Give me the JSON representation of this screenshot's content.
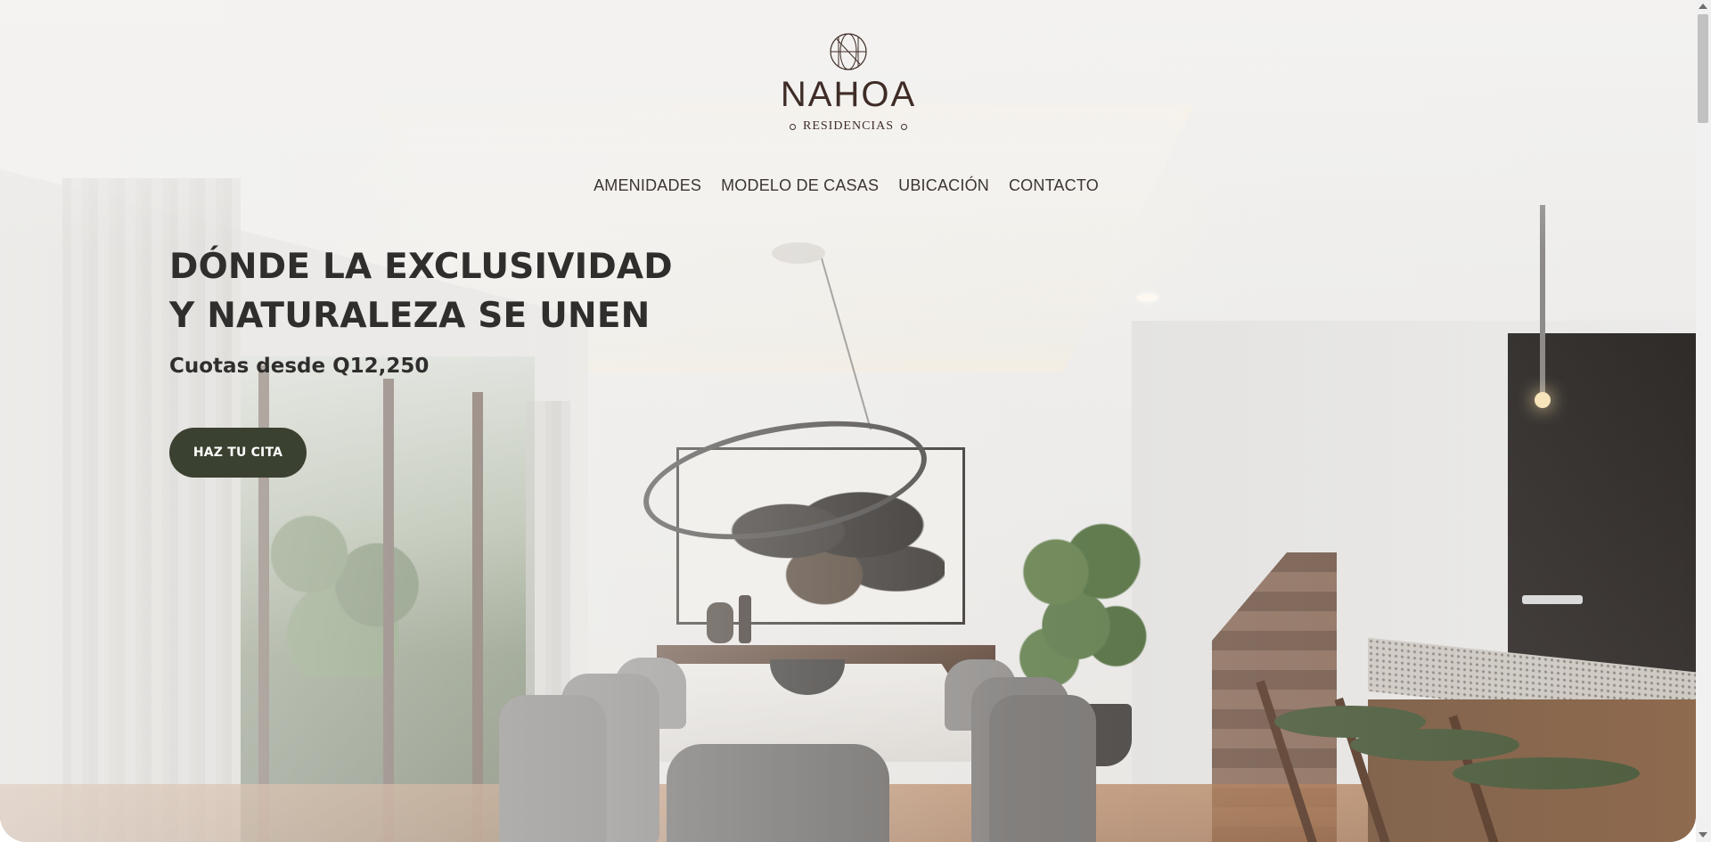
{
  "brand": {
    "name": "NAHOA",
    "subtitle": "RESIDENCIAS",
    "color": "#3f2c27"
  },
  "nav": {
    "items": [
      {
        "label": "AMENIDADES"
      },
      {
        "label": "MODELO DE CASAS"
      },
      {
        "label": "UBICACIÓN"
      },
      {
        "label": "CONTACTO"
      }
    ]
  },
  "hero": {
    "headline_line1": "DÓNDE LA EXCLUSIVIDAD",
    "headline_line2": "Y NATURALEZA SE UNEN",
    "price": "Cuotas desde Q12,250",
    "cta_label": "HAZ TU CITA",
    "cta_color": "#3b4130",
    "background_image": "dining-room-interior-render"
  },
  "scrollbar": {
    "position_fraction": 0
  }
}
